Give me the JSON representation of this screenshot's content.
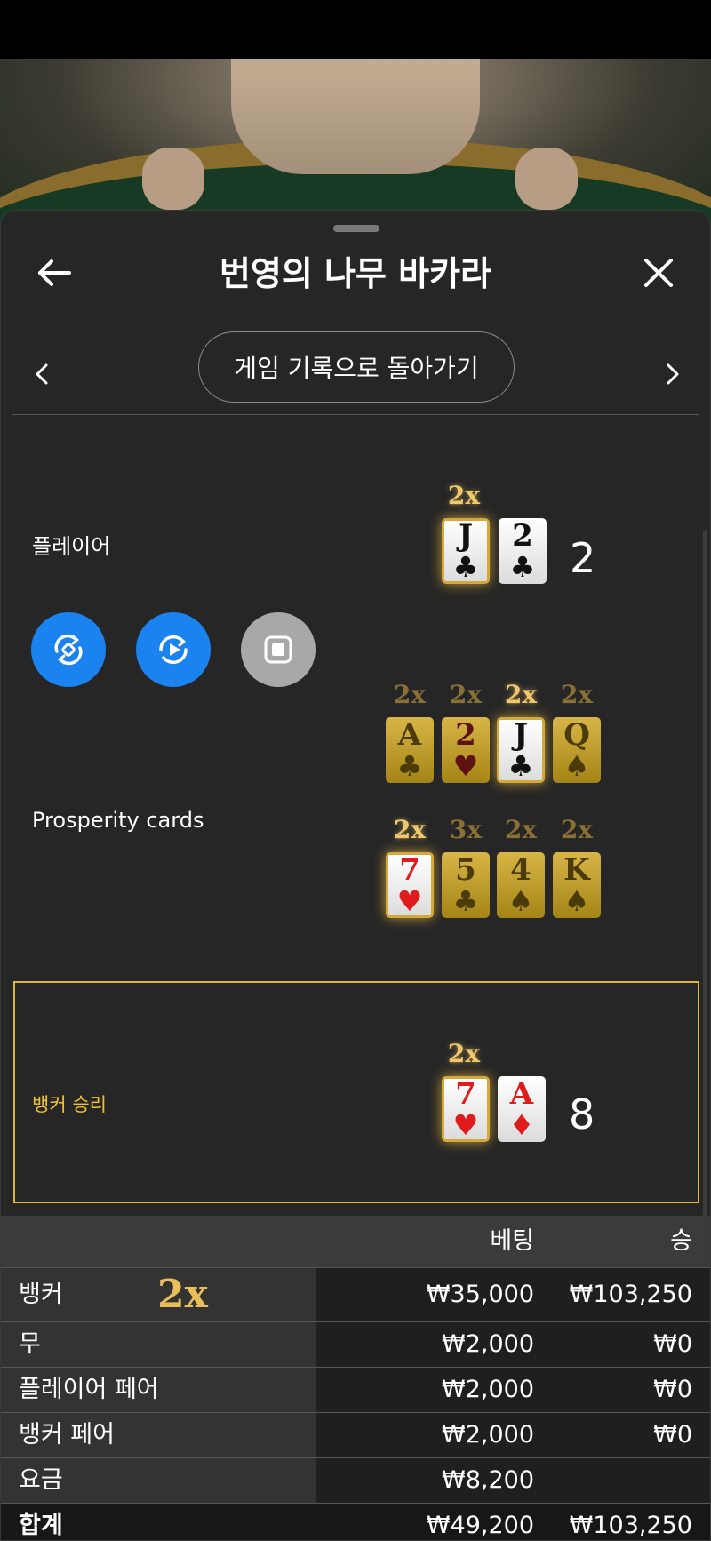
{
  "header": {
    "title": "번영의 나무 바카라"
  },
  "nav": {
    "back_to_history": "게임 기록으로 돌아가기"
  },
  "player": {
    "label": "플레이어",
    "score": "2",
    "cards": [
      {
        "rank": "J",
        "suit": "♣",
        "multiplier": "2x"
      },
      {
        "rank": "2",
        "suit": "♣"
      }
    ]
  },
  "prosperity": {
    "label": "Prosperity cards",
    "row1": [
      {
        "rank": "A",
        "suit": "♣",
        "multiplier": "2x"
      },
      {
        "rank": "2",
        "suit": "♥",
        "multiplier": "2x"
      },
      {
        "rank": "J",
        "suit": "♣",
        "multiplier": "2x"
      },
      {
        "rank": "Q",
        "suit": "♠",
        "multiplier": "2x"
      }
    ],
    "row2": [
      {
        "rank": "7",
        "suit": "♥",
        "multiplier": "2x"
      },
      {
        "rank": "5",
        "suit": "♣",
        "multiplier": "3x"
      },
      {
        "rank": "4",
        "suit": "♠",
        "multiplier": "2x"
      },
      {
        "rank": "K",
        "suit": "♠",
        "multiplier": "2x"
      }
    ]
  },
  "banker": {
    "label": "뱅커 승리",
    "score": "8",
    "cards": [
      {
        "rank": "7",
        "suit": "♥",
        "multiplier": "2x"
      },
      {
        "rank": "A",
        "suit": "♦"
      }
    ]
  },
  "table": {
    "col_bet": "베팅",
    "col_win": "승",
    "rows": [
      {
        "name": "뱅커",
        "multiplier": "2x",
        "bet": "₩35,000",
        "win": "₩103,250"
      },
      {
        "name": "무",
        "bet": "₩2,000",
        "win": "₩0"
      },
      {
        "name": "플레이어 페어",
        "bet": "₩2,000",
        "win": "₩0"
      },
      {
        "name": "뱅커 페어",
        "bet": "₩2,000",
        "win": "₩0"
      },
      {
        "name": "요금",
        "bet": "₩8,200",
        "win": ""
      }
    ],
    "total": {
      "name": "합계",
      "bet": "₩49,200",
      "win": "₩103,250"
    }
  },
  "colors": {
    "accent_gold": "#e0b52a",
    "button_blue": "#1a83f0",
    "panel": "#262626"
  },
  "icons": [
    "arrow-left-icon",
    "close-icon",
    "chevron-left-icon",
    "chevron-right-icon",
    "rotate-icon",
    "replay-icon",
    "stop-icon"
  ]
}
